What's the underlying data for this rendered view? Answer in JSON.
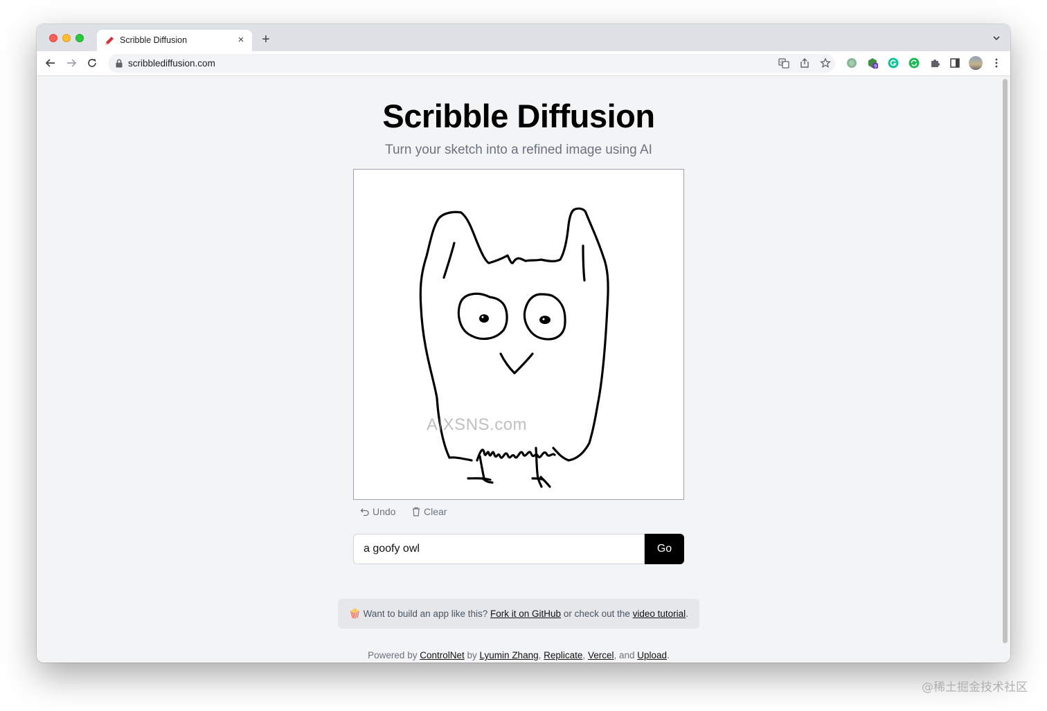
{
  "browser": {
    "tab_title": "Scribble Diffusion",
    "tab_close": "×",
    "new_tab": "+",
    "url": "scribblediffusion.com",
    "extension_badge": "9"
  },
  "page": {
    "title": "Scribble Diffusion",
    "subtitle": "Turn your sketch into a refined image using AI",
    "canvas_watermark": "AIXSNS.com",
    "undo_label": "Undo",
    "clear_label": "Clear",
    "prompt_value": "a goofy owl",
    "go_label": "Go",
    "promo": {
      "emoji": "🍿",
      "text1": "Want to build an app like this?",
      "link1": "Fork it on GitHub",
      "text2": "or check out the",
      "link2": "video tutorial",
      "text3": "."
    },
    "footer": {
      "prefix": "Powered by",
      "link_controlnet": "ControlNet",
      "by": "by",
      "link_author": "Lyumin Zhang",
      "sep1": ",",
      "link_replicate": "Replicate",
      "sep2": ",",
      "link_vercel": "Vercel",
      "sep3": ", and",
      "link_upload": "Upload",
      "end": "."
    }
  },
  "screenshot_watermark": "@稀土掘金技术社区",
  "colors": {
    "tab_strip": "#dee1e6",
    "page_bg": "#f3f4f6",
    "go_button": "#000000",
    "subtitle": "#6b7280"
  }
}
